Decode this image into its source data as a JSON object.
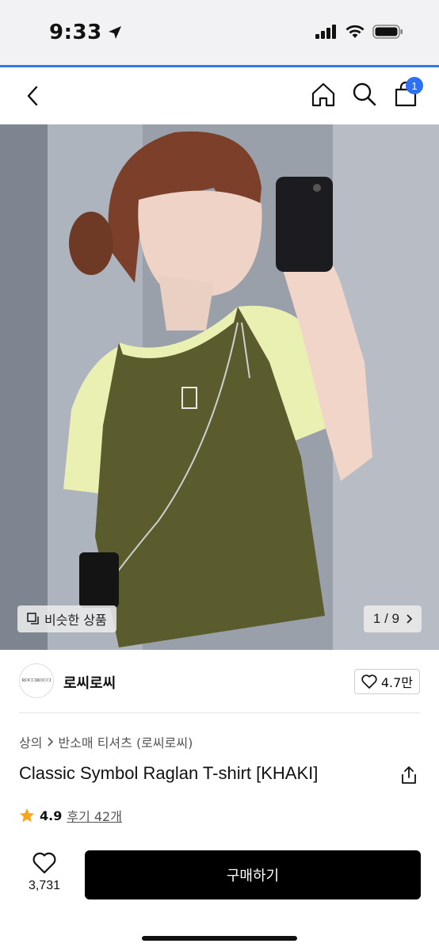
{
  "status_bar": {
    "time": "9:33"
  },
  "nav": {
    "back_icon": "chevron-left-icon",
    "home_icon": "home-icon",
    "search_icon": "search-icon",
    "cart_icon": "shopping-bag-icon",
    "cart_badge": "1",
    "accent": "#2f6ff2"
  },
  "hero": {
    "similar_label": "비슷한 상품",
    "page_counter": "1 / 9"
  },
  "shop": {
    "logo_text": "ROCCIROCCI",
    "name": "로씨로씨",
    "likes": "4.7만"
  },
  "product": {
    "breadcrumb": [
      "상의",
      "반소매 티셔츠 (로씨로씨)"
    ],
    "title": "Classic Symbol Raglan T-shirt [KHAKI]",
    "rating": "4.9",
    "reviews": "후기 42개"
  },
  "bottom": {
    "like_count": "3,731",
    "buy_label": "구매하기"
  }
}
